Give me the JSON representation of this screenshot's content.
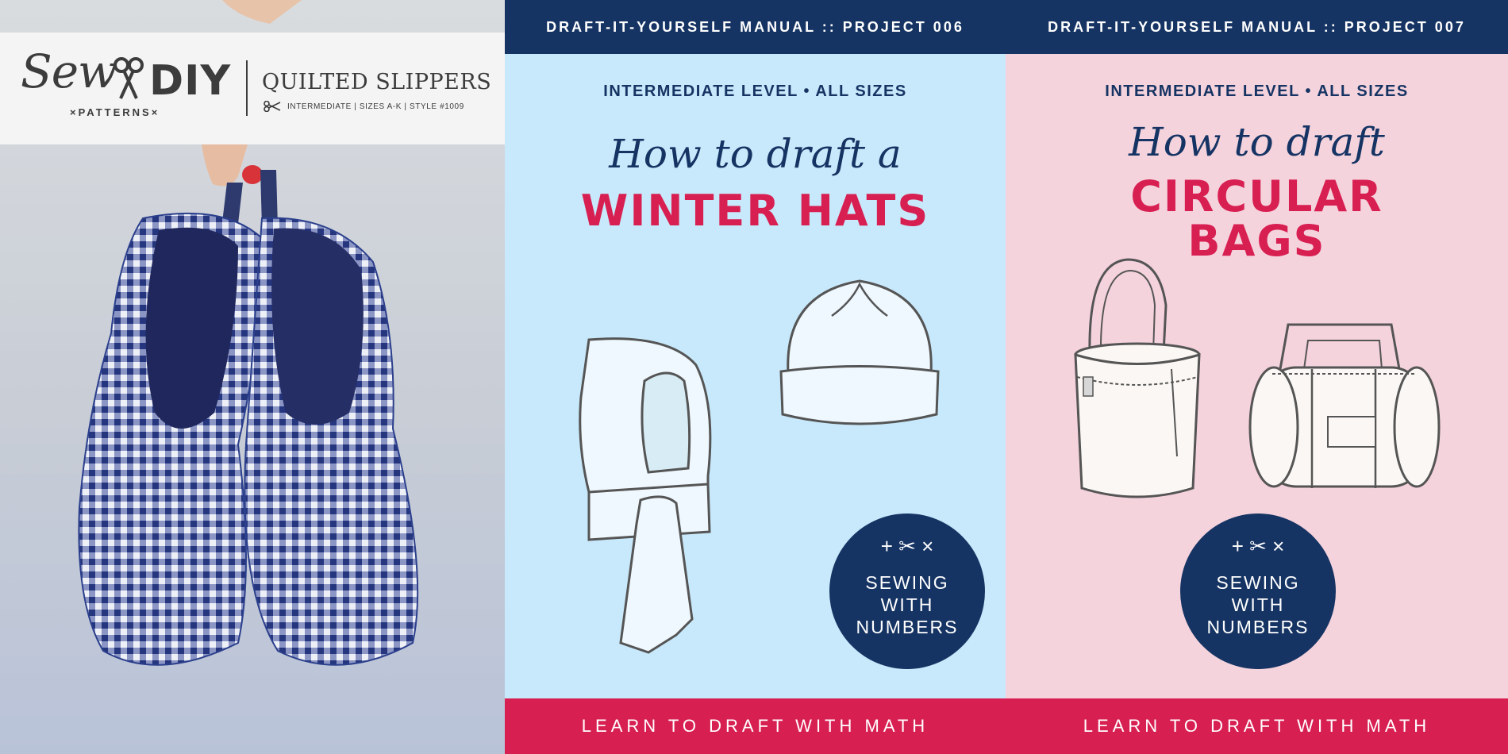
{
  "cover": {
    "logo": {
      "script": "Sew",
      "diy": "DIY",
      "sub": "×PATTERNS×"
    },
    "product_title": "QUILTED SLIPPERS",
    "product_meta": "INTERMEDIATE | SIZES A-K | STYLE #1009",
    "icons": [
      "scissors-icon"
    ]
  },
  "panels": [
    {
      "header": "DRAFT-IT-YOURSELF MANUAL :: PROJECT 006",
      "level": "INTERMEDIATE LEVEL • ALL SIZES",
      "script": "How to draft a",
      "title_lines": [
        "WINTER HATS"
      ],
      "badge": {
        "marks": "+ ✂ ×",
        "lines": [
          "SEWING",
          "WITH",
          "NUMBERS"
        ]
      },
      "footer": "LEARN TO DRAFT WITH MATH"
    },
    {
      "header": "DRAFT-IT-YOURSELF MANUAL :: PROJECT 007",
      "level": "INTERMEDIATE LEVEL • ALL SIZES",
      "script": "How to draft",
      "title_lines": [
        "CIRCULAR",
        "BAGS"
      ],
      "badge": {
        "marks": "+ ✂ ×",
        "lines": [
          "SEWING",
          "WITH",
          "NUMBERS"
        ]
      },
      "footer": "LEARN TO DRAFT WITH MATH"
    }
  ],
  "colors": {
    "navy": "#163463",
    "crimson": "#d81f52",
    "light_blue": "#c8e9fb",
    "light_pink": "#f5d3dd",
    "gingham": "#2b3f8c"
  }
}
